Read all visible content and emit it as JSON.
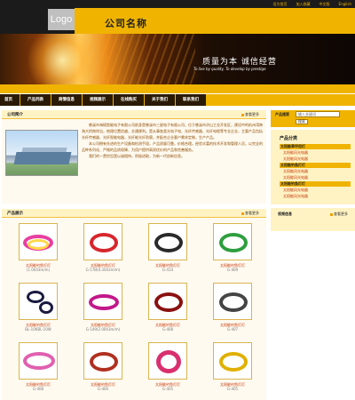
{
  "header": {
    "logo": "Logo",
    "company_name": "公司名称",
    "top_links": [
      "设为首页",
      "加入收藏",
      "中文版",
      "English"
    ]
  },
  "banner": {
    "slogan": "质量为本  诚信经营",
    "slogan_en": "To live by quality, To develop by prestige"
  },
  "nav": {
    "items": [
      "首页",
      "产品列表",
      "商情信息",
      "视频展示",
      "在线购买",
      "关于我们",
      "联系我们"
    ]
  },
  "about": {
    "title": "公司简介",
    "more": "查看更多",
    "paragraphs": [
      "慈溪市海硕智能电子有限公司前身是慈溪市三星电子有限公司，位于慈溪市浒山工业开发区，建设中的杭州湾跨海大桥南岸出，地理位置优越，交通便利。是从事各类光电子电、光纤传感器、光纤电缆等专业企业，主要产品包括光纤传感器、光纤智能电器、光纤能光纤防腐，并配合企业客户需求定制，生产产品。",
      "本公司拥有先进的生产设备和检测手段，产品质量可靠，价格合理。经验丰富的技术开发和管理人员，以完全的品种系列化、严格的品质保障、为用户提供高质优价的产品和完善服务。",
      "我们的一贯宗旨是以诚相待，积极进取，为新一代创新信息。"
    ]
  },
  "products": {
    "title": "产品展示",
    "more": "查看更多",
    "items": [
      {
        "name": "太阳能钓鱼灯灯",
        "model": "(1.0043m/m)"
      },
      {
        "name": "太阳能钓鱼灯灯",
        "model": "G-17B(0.3043m/m)"
      },
      {
        "name": "太阳能钓鱼灯灯",
        "model": "G-414"
      },
      {
        "name": "太阳能钓鱼灯灯",
        "model": "G-409"
      },
      {
        "name": "太阳能钓鱼灯灯",
        "model": "BL-10KBL-10W"
      },
      {
        "name": "太阳能钓鱼灯灯",
        "model": "G-149(2.0043m/m)"
      },
      {
        "name": "太阳能钓鱼灯灯",
        "model": "G-408"
      },
      {
        "name": "太阳能钓鱼灯灯",
        "model": "G-407"
      },
      {
        "name": "太阳能钓鱼灯灯",
        "model": "G-408"
      },
      {
        "name": "太阳能钓鱼灯灯",
        "model": "G-400"
      },
      {
        "name": "太阳能钓鱼灯灯",
        "model": "G-405"
      },
      {
        "name": "太阳能钓鱼灯灯",
        "model": "G-405"
      }
    ]
  },
  "sidebar": {
    "search": {
      "label": "产品搜索",
      "placeholder": "输入关键词",
      "button": "搜索"
    },
    "categories": {
      "title": "产品分类",
      "items": [
        {
          "level": 1,
          "label": "太阳能草坪用灯"
        },
        {
          "level": 2,
          "label": "太阳能风光电器"
        },
        {
          "level": 2,
          "label": "太阳能风光电器"
        },
        {
          "level": 1,
          "label": "太阳能钓鱼灯灯"
        },
        {
          "level": 2,
          "label": "太阳能风光电器"
        },
        {
          "level": 2,
          "label": "太阳能风光电器"
        },
        {
          "level": 1,
          "label": "太阳能钓鱼灯灯"
        },
        {
          "level": 2,
          "label": "太阳能风光电器"
        },
        {
          "level": 2,
          "label": "太阳能风光电器"
        }
      ]
    },
    "video": {
      "title": "视频信息",
      "more": "查看更多"
    }
  },
  "colors": {
    "accent": "#f0b400",
    "dark": "#1b1b1b",
    "panel": "#fff3c4",
    "link": "#c03000"
  }
}
